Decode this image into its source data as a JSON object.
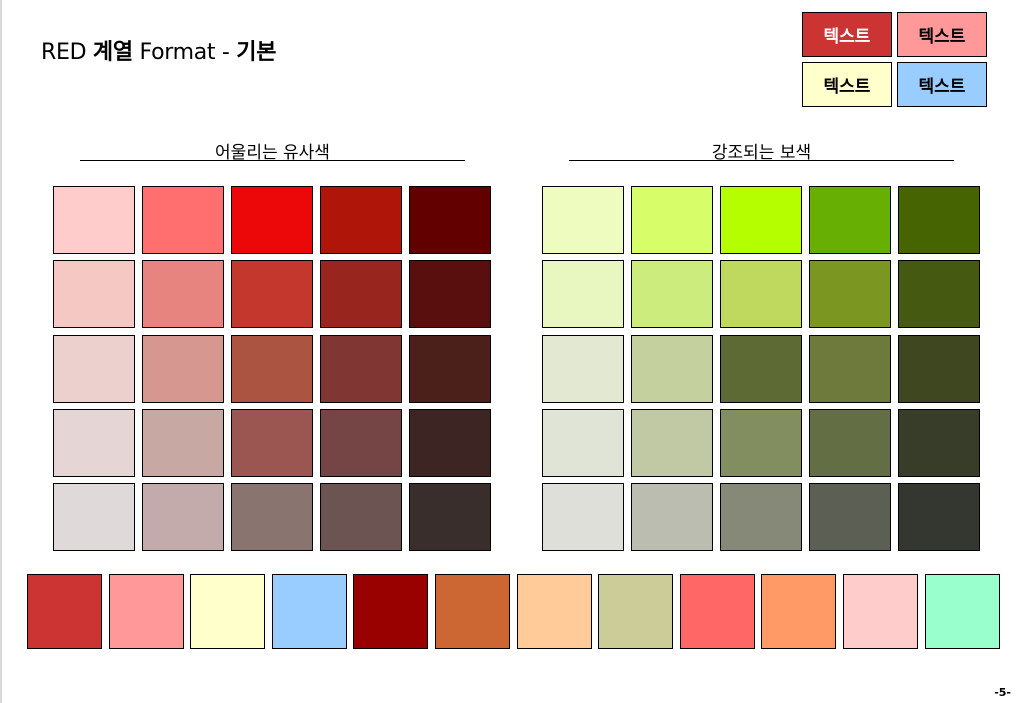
{
  "title": {
    "prefix": "RED ",
    "series": "계열",
    "middle": " Format - ",
    "basic": "기본"
  },
  "samples": [
    {
      "label": "텍스트",
      "bg": "#CC3333",
      "fg": "#FFFFFF"
    },
    {
      "label": "텍스트",
      "bg": "#FF9999",
      "fg": "#000000"
    },
    {
      "label": "텍스트",
      "bg": "#FFFFCC",
      "fg": "#000000"
    },
    {
      "label": "텍스트",
      "bg": "#99CCFF",
      "fg": "#000000"
    }
  ],
  "sections": {
    "analogous": {
      "title": "어울리는 유사색",
      "rows": [
        [
          "#FFCCCC",
          "#FF6F6F",
          "#EC0808",
          "#B0150A",
          "#620000"
        ],
        [
          "#F5C8C3",
          "#E88480",
          "#C4372D",
          "#98261F",
          "#5A0F0F"
        ],
        [
          "#EBD0CE",
          "#D69790",
          "#AC5442",
          "#803633",
          "#4B201B"
        ],
        [
          "#E5D6D5",
          "#C8A8A2",
          "#9C5652",
          "#754444",
          "#3D2523"
        ],
        [
          "#E0D9DA",
          "#C2ABAA",
          "#8A746F",
          "#6B5452",
          "#3A2E2C"
        ]
      ]
    },
    "complementary": {
      "title": "강조되는 보색",
      "rows": [
        [
          "#EEFCC0",
          "#D7FE68",
          "#B4FE00",
          "#67B003",
          "#476402"
        ],
        [
          "#E8F6C0",
          "#CDEC7E",
          "#BED95E",
          "#7C9721",
          "#465911"
        ],
        [
          "#E3E8D2",
          "#C4D19E",
          "#5D6A33",
          "#6E7A3C",
          "#3F4721"
        ],
        [
          "#E0E4D6",
          "#C1C8A4",
          "#828E5F",
          "#646E45",
          "#373D28"
        ],
        [
          "#DEDFD8",
          "#BABDAF",
          "#868977",
          "#5C6054",
          "#333730"
        ]
      ]
    }
  },
  "bottom_palette": [
    "#CC3333",
    "#FF9999",
    "#FFFFCC",
    "#99CCFF",
    "#990000",
    "#CC6633",
    "#FFCC99",
    "#CCCC99",
    "#FF6666",
    "#FF9966",
    "#FFCCCC",
    "#99FFCC"
  ],
  "page_number": "-5-"
}
